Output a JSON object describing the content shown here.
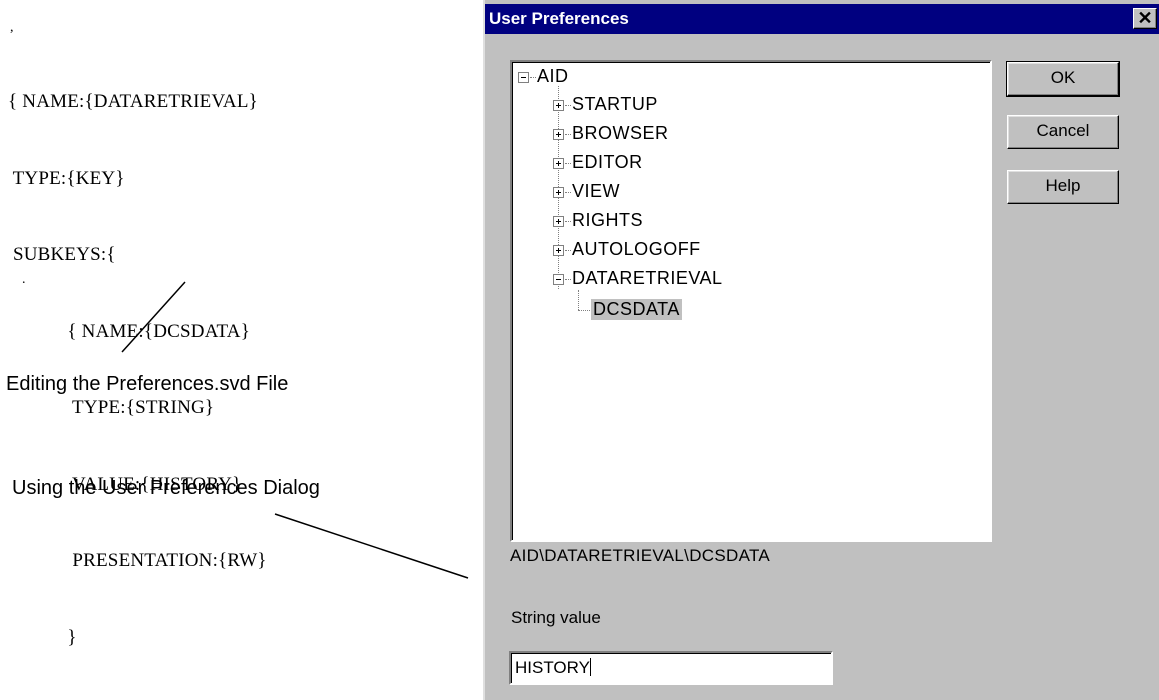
{
  "annotation": {
    "code_lines": [
      "{ NAME:{DATARETRIEVAL}",
      " TYPE:{KEY}",
      " SUBKEYS:{",
      "            { NAME:{DCSDATA}",
      "             TYPE:{STRING}",
      "             VALUE:{HISTORY}",
      "             PRESENTATION:{RW}",
      "            }"
    ],
    "caption_file": "Editing the Preferences.svd File",
    "caption_dialog": "Using the User Preferences Dialog"
  },
  "dialog": {
    "title": "User Preferences",
    "close_glyph": "✕",
    "tree": {
      "root": "AID",
      "children": [
        "STARTUP",
        "BROWSER",
        "EDITOR",
        "VIEW",
        "RIGHTS",
        "AUTOLOGOFF",
        "DATARETRIEVAL"
      ],
      "expanded_child": "DATARETRIEVAL",
      "leaf": "DCSDATA"
    },
    "buttons": {
      "ok": "OK",
      "cancel": "Cancel",
      "help": "Help"
    },
    "path": "AID\\DATARETRIEVAL\\DCSDATA",
    "string_value_label": "String value",
    "string_value": "HISTORY"
  }
}
